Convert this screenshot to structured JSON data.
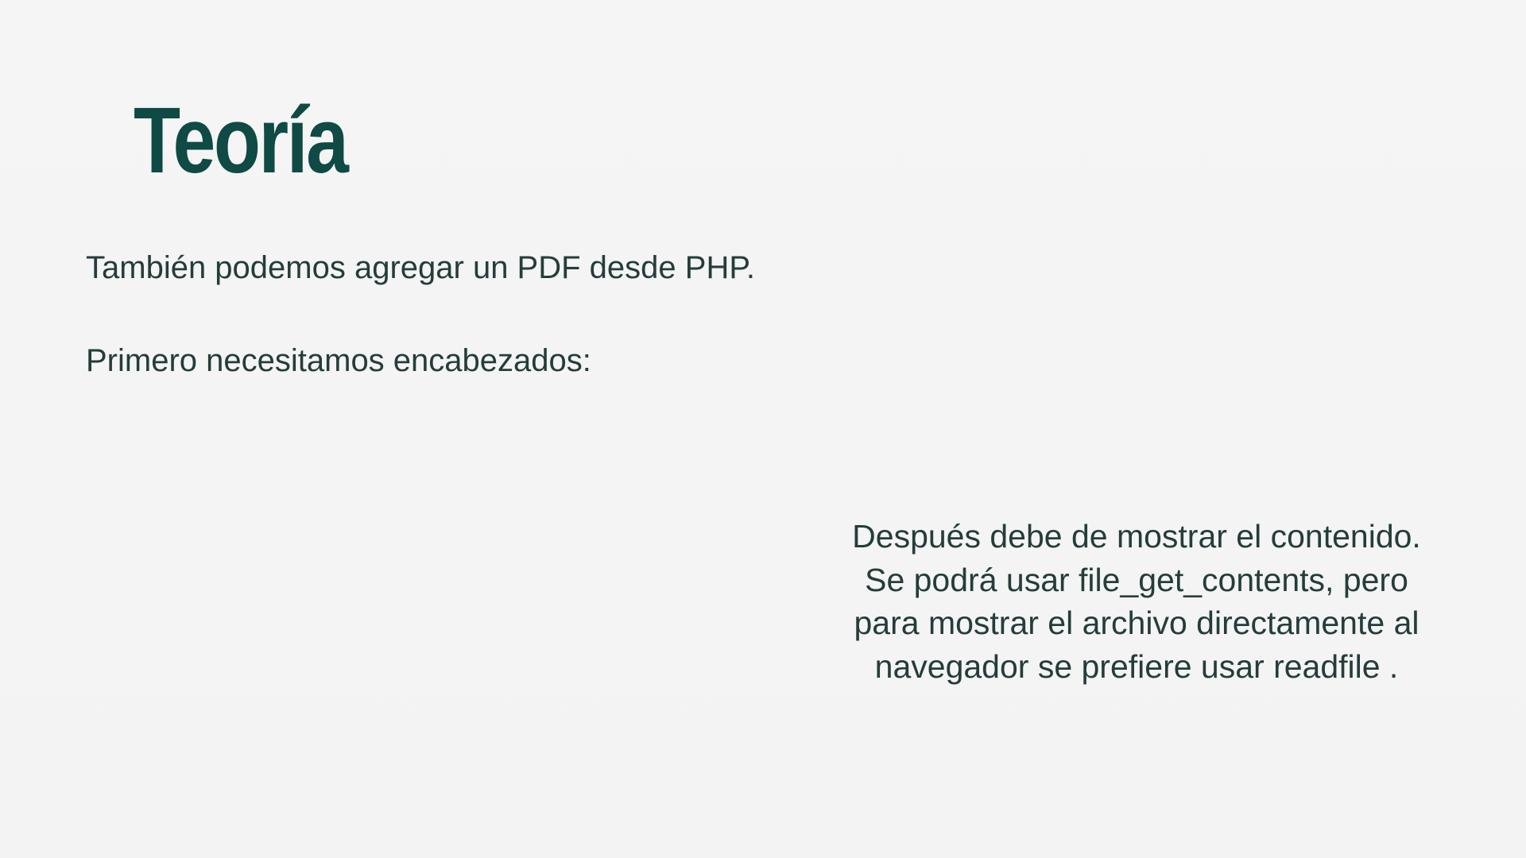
{
  "slide": {
    "title": "Teoría",
    "paragraph_1": "También podemos agregar un PDF desde PHP.",
    "paragraph_2": "Primero necesitamos encabezados:",
    "right_text_lines": [
      "Después debe de mostrar el contenido.",
      "Se podrá usar  file_get_contents, pero",
      "para mostrar el archivo directamente al",
      "navegador se prefiere usar  readfile ."
    ]
  },
  "colors": {
    "background": "#f4f4f4",
    "title": "#0f4a44",
    "text": "#243d3b"
  }
}
